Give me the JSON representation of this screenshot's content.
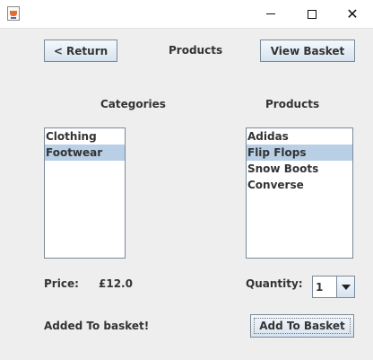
{
  "window": {
    "title": "",
    "app_icon": "java-cup-icon",
    "controls": [
      "minimize-icon",
      "maximize-icon",
      "close-icon"
    ],
    "close_glyph": "✕"
  },
  "toolbar": {
    "return_label": "< Return",
    "page_title": "Products",
    "view_basket_label": "View Basket"
  },
  "categories": {
    "heading": "Categories",
    "items": [
      {
        "label": "Clothing",
        "selected": false
      },
      {
        "label": "Footwear",
        "selected": true
      }
    ]
  },
  "products": {
    "heading": "Products",
    "items": [
      {
        "label": "Adidas",
        "selected": false
      },
      {
        "label": "Flip Flops",
        "selected": true
      },
      {
        "label": "Snow Boots",
        "selected": false
      },
      {
        "label": "Converse",
        "selected": false
      }
    ]
  },
  "price": {
    "label": "Price:",
    "value": "£12.0"
  },
  "quantity": {
    "label": "Quantity:",
    "value": "1"
  },
  "footer": {
    "status": "Added To basket!",
    "add_to_basket_label": "Add To Basket"
  },
  "colors": {
    "background": "#eeeeee",
    "selection": "#b8cfe5",
    "button_border": "#7a8a99"
  }
}
